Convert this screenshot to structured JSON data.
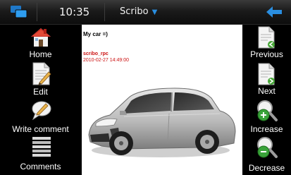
{
  "status_bar": {
    "time": "10:35",
    "app_title": "Scribo",
    "switcher_icon": "task-switcher-icon",
    "back_icon": "back-arrow-icon",
    "accent_color": "#2a8ee0"
  },
  "left_toolbar": {
    "home_label": "Home",
    "edit_label": "Edit",
    "write_comment_label": "Write comment",
    "comments_label": "Comments"
  },
  "right_toolbar": {
    "previous_label": "Previous",
    "next_label": "Next",
    "increase_label": "Increase",
    "decrease_label": "Decrease"
  },
  "post": {
    "title": "My car =)",
    "author": "scribo_rpc",
    "date": "2010-02-27 14:49:00",
    "author_color": "#cc1111"
  }
}
